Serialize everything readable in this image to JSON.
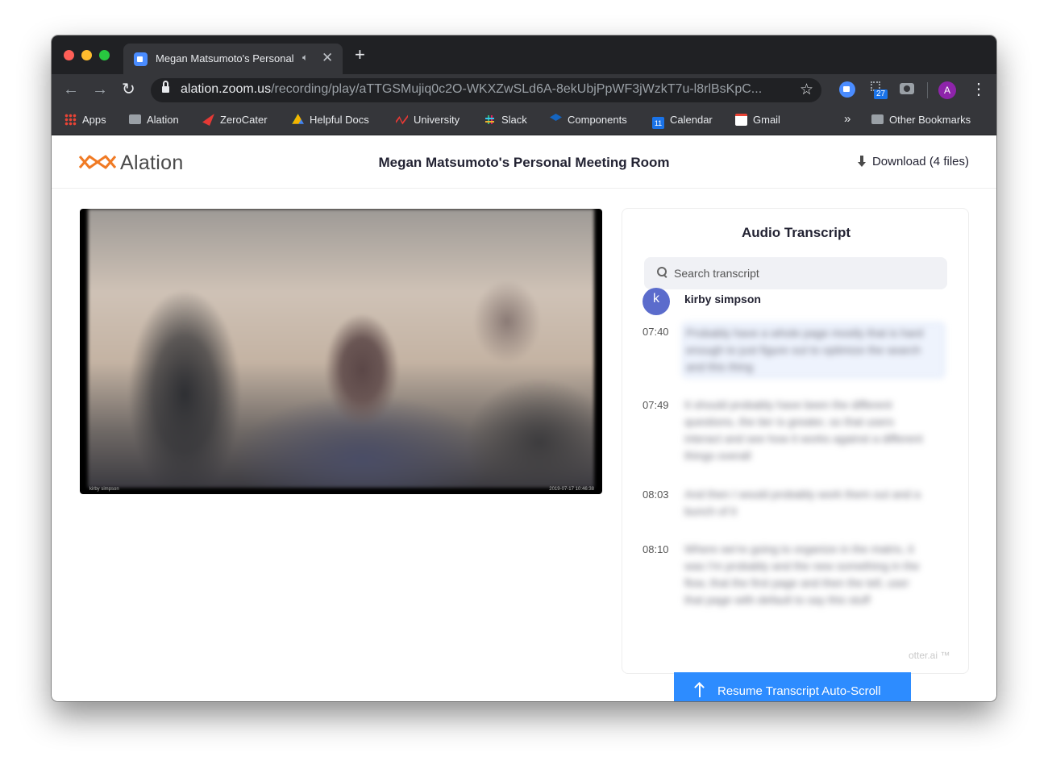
{
  "browser": {
    "tab_title": "Megan Matsumoto's Personal Meeting Room",
    "tab_audio_icon": "speaker-icon",
    "new_tab_label": "+",
    "url_host": "alation.zoom.us",
    "url_path": "/recording/play/aTTGSMujiq0c2O-WKXZwSLd6A-8ekUbjPpWF3jWzkT7u-l8rlBsKpC...",
    "profile_initial": "A",
    "extension_badge": "27",
    "colors": {
      "chrome_dark": "#202124",
      "chrome_mid": "#35363a",
      "zoom_blue": "#2d8cff",
      "profile": "#8e24aa"
    }
  },
  "bookmarks": {
    "items": [
      {
        "label": "Apps",
        "icon": "apps-grid-icon"
      },
      {
        "label": "Alation",
        "icon": "folder-icon"
      },
      {
        "label": "ZeroCater",
        "icon": "zerocater-icon"
      },
      {
        "label": "Helpful Docs",
        "icon": "google-drive-icon"
      },
      {
        "label": "University",
        "icon": "university-icon"
      },
      {
        "label": "Slack",
        "icon": "slack-icon"
      },
      {
        "label": "Components",
        "icon": "components-icon"
      },
      {
        "label": "Calendar",
        "icon": "calendar-icon",
        "icon_text": "11"
      },
      {
        "label": "Gmail",
        "icon": "gmail-icon"
      }
    ],
    "overflow": "»",
    "other": "Other Bookmarks"
  },
  "page": {
    "logo_text": "Alation",
    "meeting_title": "Megan Matsumoto's Personal Meeting Room",
    "download_label": "Download (4 files)"
  },
  "video": {
    "overlay_name": "kirby simpson",
    "overlay_time": "2019-07-17 10:46:38"
  },
  "transcript": {
    "title": "Audio Transcript",
    "search_placeholder": "Search transcript",
    "speaker": {
      "initial": "k",
      "name": "kirby simpson"
    },
    "entries": [
      {
        "time": "07:40",
        "text": "Probably have a whole page mostly that is hard enough to just figure out to optimize the search and this thing"
      },
      {
        "time": "07:49",
        "text": "It should probably have been the different questions, the tier is greater, so that users interact and see how it works against a different things overall"
      },
      {
        "time": "08:03",
        "text": "And then I would probably work them out and a bunch of it"
      },
      {
        "time": "08:10",
        "text": "Where we're going to organize in the matrix, it was I'm probably and the new something in the flow, that the first page and then the tell, user that page with default to say this stuff"
      }
    ],
    "powered_by": "otter.ai ™",
    "resume_label": "Resume Transcript Auto-Scroll"
  }
}
